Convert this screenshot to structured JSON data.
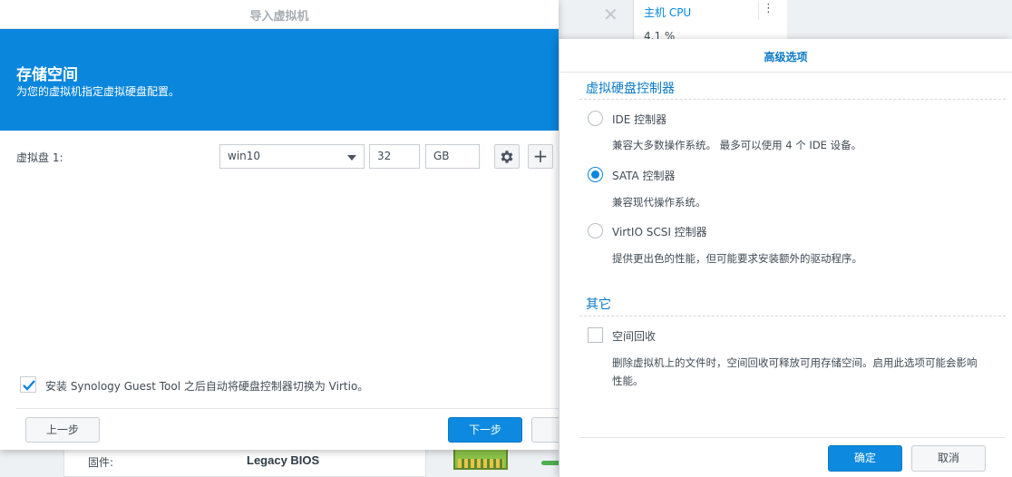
{
  "background": {
    "cpu_label": "主机 CPU",
    "cpu_value": "4.1 %",
    "firmware_label": "固件:",
    "firmware_value": "Legacy BIOS"
  },
  "import_dialog": {
    "title": "导入虚拟机",
    "header_title": "存储空间",
    "header_subtitle": "为您的虚拟机指定虚拟硬盘配置。",
    "disk_label": "虚拟盘 1:",
    "disk_select_value": "win10",
    "disk_size_value": "32",
    "disk_unit_value": "GB",
    "guest_tool_checkbox_label": "安装 Synology Guest Tool 之后自动将硬盘控制器切换为 Virtio。",
    "guest_tool_checked": true,
    "prev_label": "上一步",
    "next_label": "下一步"
  },
  "advanced_dialog": {
    "title": "高级选项",
    "controller_section_title": "虚拟硬盘控制器",
    "options": [
      {
        "label": "IDE 控制器",
        "desc": "兼容大多数操作系统。 最多可以使用 4 个 IDE 设备。",
        "selected": false
      },
      {
        "label": "SATA 控制器",
        "desc": "兼容现代操作系统。",
        "selected": true
      },
      {
        "label": "VirtIO SCSI 控制器",
        "desc": "提供更出色的性能，但可能要求安装额外的驱动程序。",
        "selected": false
      }
    ],
    "other_section_title": "其它",
    "space_reclaim_label": "空间回收",
    "space_reclaim_checked": false,
    "space_reclaim_desc": "删除虚拟机上的文件时，空间回收可释放可用存储空间。启用此选项可能会影响性能。",
    "ok_label": "确定",
    "cancel_label": "取消"
  },
  "colors": {
    "accent": "#0a86dd",
    "header_bg": "#0a86dd"
  }
}
